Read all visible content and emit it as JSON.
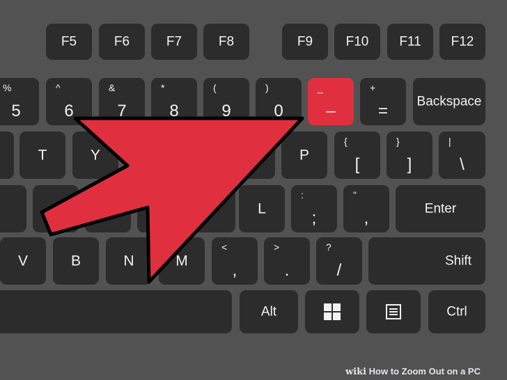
{
  "colors": {
    "frame": "#a9b8a1",
    "keyboard": "#525252",
    "key": "#2c2c2c",
    "highlight": "#e0303f",
    "arrow": "#e0303f",
    "text": "#f2f2f2"
  },
  "rows": {
    "fn": [
      "F5",
      "F6",
      "F7",
      "F8",
      "F9",
      "F10",
      "F11",
      "F12"
    ],
    "num": [
      {
        "shift": "%",
        "main": "5"
      },
      {
        "shift": "^",
        "main": "6"
      },
      {
        "shift": "&",
        "main": "7"
      },
      {
        "shift": "*",
        "main": "8"
      },
      {
        "shift": "(",
        "main": "9"
      },
      {
        "shift": ")",
        "main": "0"
      },
      {
        "shift": "_",
        "main": "–"
      },
      {
        "shift": "+",
        "main": "="
      }
    ],
    "backspace": "Backspace",
    "top": {
      "t": "T",
      "y": "Y",
      "p": "P",
      "lbrace": "{",
      "lbracket": "[",
      "rbrace": "}",
      "rbracket": "]",
      "pipe": "|",
      "backslash": "\\"
    },
    "home": {
      "l": "L",
      "colon": ":",
      "semicolon": ";",
      "quote": "\"",
      "apos": ",",
      "enter": "Enter"
    },
    "bottom": {
      "v": "V",
      "b": "B",
      "n": "N",
      "m": "M",
      "lt": "<",
      "comma": ",",
      "gt": ">",
      "period": ".",
      "question": "?",
      "slash": "/",
      "shift": "Shift"
    },
    "space": {
      "alt": "Alt",
      "ctrl": "Ctrl",
      "windows": "windows-icon",
      "menu": "menu-icon"
    }
  },
  "arrow": {
    "icon": "arrow-pointer",
    "target": "minus-key"
  },
  "watermark": {
    "brand": "wiki",
    "title": "How to Zoom Out on a PC"
  }
}
